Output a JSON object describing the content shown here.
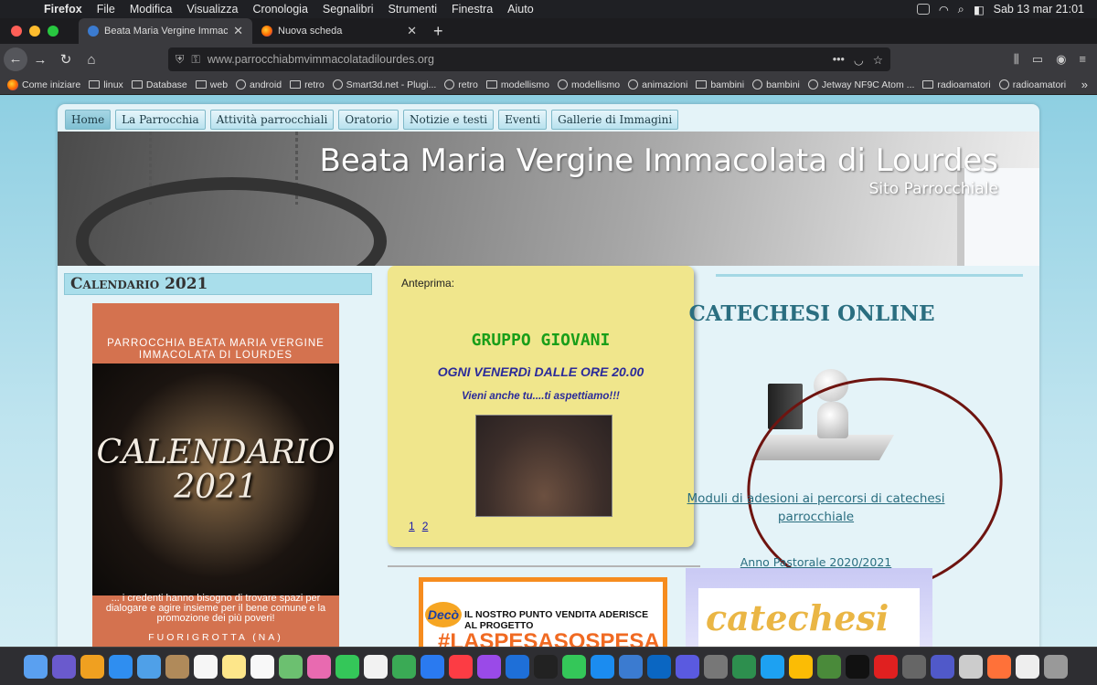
{
  "menubar": {
    "app": "Firefox",
    "items": [
      "File",
      "Modifica",
      "Visualizza",
      "Cronologia",
      "Segnalibri",
      "Strumenti",
      "Finestra",
      "Aiuto"
    ],
    "datetime": "Sab 13 mar  21:01"
  },
  "tabs": [
    {
      "title": "Beata Maria Vergine Immacolat",
      "active": true
    },
    {
      "title": "Nuova scheda",
      "active": false
    }
  ],
  "url": {
    "host": "www.parrocchiabmvimmacolatadilourdes.org"
  },
  "bookmarks": [
    "Come iniziare",
    "linux",
    "Database",
    "web",
    "android",
    "retro",
    "Smart3d.net - Plugi...",
    "retro",
    "modellismo",
    "modellismo",
    "animazioni",
    "bambini",
    "bambini",
    "Jetway NF9C Atom ...",
    "radioamatori",
    "radioamatori"
  ],
  "site": {
    "nav": [
      "Home",
      "La Parrocchia",
      "Attività parrocchiali",
      "Oratorio",
      "Notizie e testi",
      "Eventi",
      "Gallerie di Immagini"
    ],
    "banner": {
      "title": "Beata Maria Vergine Immacolata di Lourdes",
      "subtitle": "Sito Parrocchiale"
    },
    "calendar": {
      "header": "Calendario 2021",
      "poster_top": "PARROCCHIA BEATA MARIA VERGINE IMMACOLATA DI LOURDES",
      "poster_big": "CALENDARIO 2021",
      "poster_caption": "... i credenti hanno bisogno di trovare spazi per dialogare e agire insieme per il bene comune e la promozione dei più poveri!",
      "poster_footer": "FUORIGROTTA (NA)"
    },
    "preview": {
      "label": "Anteprima:",
      "group": "GRUPPO GIOVANI",
      "when": "OGNI VENERDì DALLE ORE 20.00",
      "come": "Vieni anche tu....ti aspettiamo!!!",
      "pages": [
        "1",
        "2"
      ]
    },
    "spesa": {
      "brand": "Decò",
      "line1": "IL NOSTRO PUNTO VENDITA ADERISCE AL PROGETTO",
      "line2": "#LASPESASOSPESA"
    },
    "catechesi": {
      "title": "CATECHESI ONLINE",
      "link": "Moduli di adesioni ai percorsi di catechesi parrocchiale",
      "anno": "Anno Pastorale 2020/2021",
      "img_word": "catechesi"
    }
  },
  "colors": {
    "accent": "#2a6e80",
    "preview_bg": "#f0e68c",
    "group_green": "#199e19",
    "circle": "#6e1410"
  }
}
